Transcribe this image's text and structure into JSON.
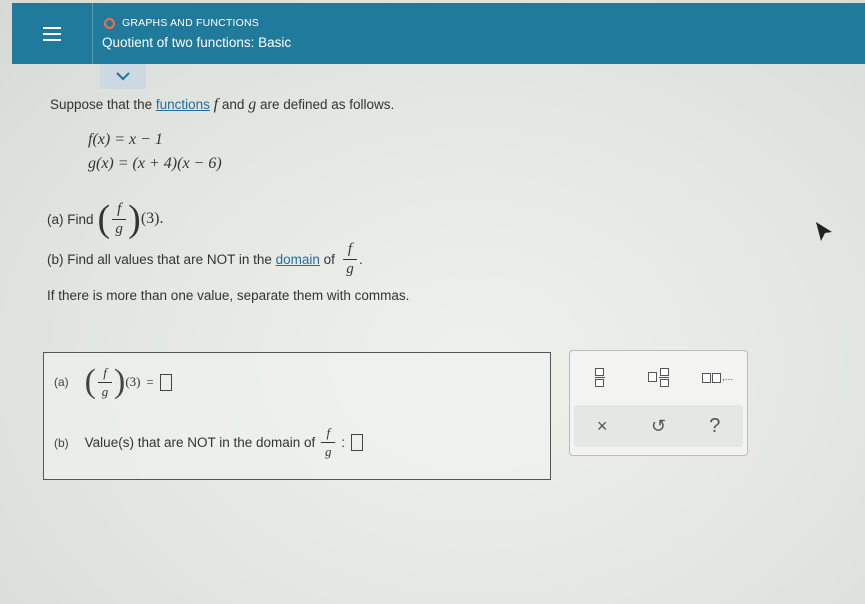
{
  "header": {
    "category": "GRAPHS AND FUNCTIONS",
    "title": "Quotient of two functions: Basic"
  },
  "problem": {
    "intro_pre": "Suppose that the",
    "intro_link": "functions",
    "intro_f": "f",
    "intro_and": "and",
    "intro_g": "g",
    "intro_post": "are defined as follows.",
    "eq1": "f(x) = x − 1",
    "eq2": "g(x) = (x + 4)(x − 6)",
    "part_a_label": "(a) Find",
    "part_a_arg": "(3).",
    "frac_num": "f",
    "frac_den": "g",
    "part_b_pre": "(b) Find all values that are NOT in the",
    "part_b_link": "domain",
    "part_b_of": "of",
    "part_b_end": ".",
    "hint": "If there is more than one value, separate them with commas."
  },
  "answer": {
    "a_tag": "(a)",
    "a_arg": "(3)",
    "a_eq": "=",
    "b_tag": "(b)",
    "b_text": "Value(s) that are NOT in the domain of",
    "b_colon": ":"
  },
  "toolbar": {
    "list_dots": ",...",
    "clear": "×",
    "undo": "↺",
    "help": "?"
  },
  "icons": [
    "menu-icon",
    "chevron-down-icon",
    "fraction-icon",
    "mixed-number-icon",
    "list-icon",
    "clear-icon",
    "undo-icon",
    "help-icon"
  ],
  "colors": {
    "header": "#1f7a9c",
    "accent_dot": "#ff6a3d",
    "link": "#1f6fa1"
  }
}
